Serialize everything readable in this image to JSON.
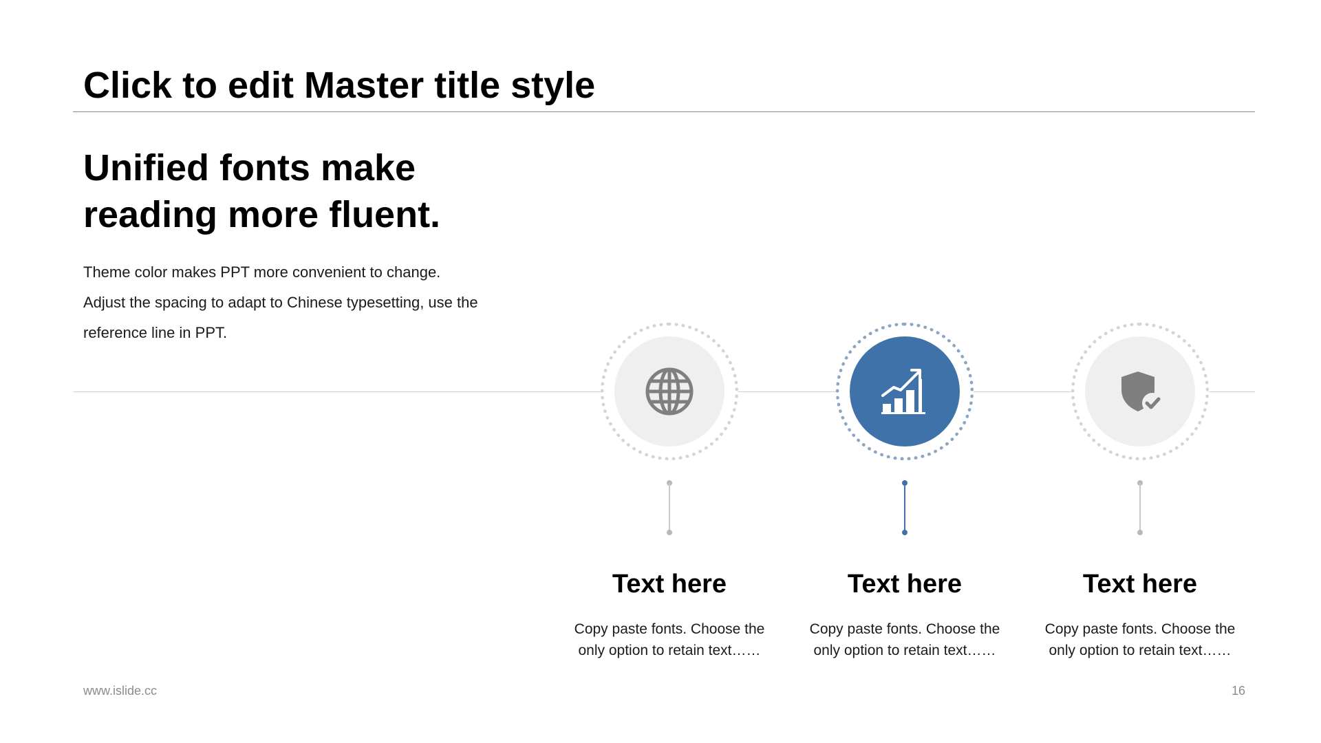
{
  "slide": {
    "title": "Click to edit Master title style",
    "headline": {
      "line1": "Unified fonts make",
      "line2": "reading more fluent."
    },
    "body": {
      "line1": "Theme color makes PPT more convenient to change.",
      "line2": "Adjust the spacing to adapt to Chinese typesetting, use the",
      "line3": "reference line in PPT."
    }
  },
  "steps": [
    {
      "icon": "globe-icon",
      "highlighted": false,
      "title": "Text here",
      "desc_line1": "Copy paste fonts. Choose the",
      "desc_line2": "only option to retain text……"
    },
    {
      "icon": "growth-chart-icon",
      "highlighted": true,
      "title": "Text here",
      "desc_line1": "Copy paste fonts. Choose the",
      "desc_line2": "only option to retain text……"
    },
    {
      "icon": "shield-check-icon",
      "highlighted": false,
      "title": "Text here",
      "desc_line1": "Copy paste fonts. Choose the",
      "desc_line2": "only option to retain text……"
    }
  ],
  "footer": {
    "url": "www.islide.cc",
    "page_number": "16"
  },
  "colors": {
    "accent": "#3f72a8",
    "accent_ring": "#8aa6c6",
    "neutral_disc": "#efefef",
    "neutral_icon": "#7f7f7f"
  }
}
